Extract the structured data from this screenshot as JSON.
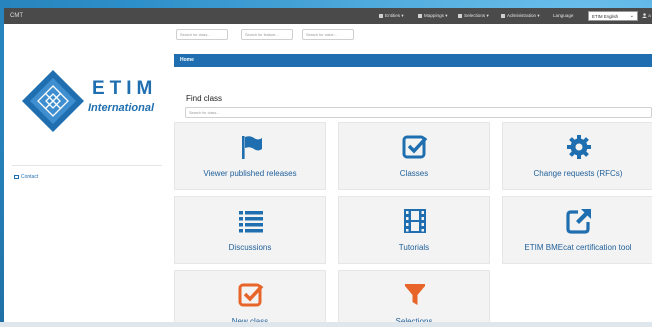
{
  "topnav": {
    "brand": "CMT",
    "items": [
      "Entities",
      "Mappings",
      "Selections",
      "Administration",
      "Language"
    ],
    "language": "ETIM English",
    "user_icon": "user-icon"
  },
  "search": {
    "class_placeholder": "Search for class...",
    "feature_placeholder": "Search for feature...",
    "value_placeholder": "Search for value..."
  },
  "logo": {
    "name": "ETIM",
    "sub": "International"
  },
  "sidebar": {
    "contact": "Contact"
  },
  "breadcrumb": "Home",
  "find": {
    "title": "Find class",
    "placeholder": "Search for class..."
  },
  "tiles": [
    {
      "label": "Viewer published releases",
      "icon": "flag-icon",
      "color": "#1f6fb0"
    },
    {
      "label": "Classes",
      "icon": "check-square-icon",
      "color": "#1f6fb0"
    },
    {
      "label": "Change requests (RFCs)",
      "icon": "gear-icon",
      "color": "#1f6fb0"
    },
    {
      "label": "Discussions",
      "icon": "list-icon",
      "color": "#1f6fb0"
    },
    {
      "label": "Tutorials",
      "icon": "film-icon",
      "color": "#1f6fb0"
    },
    {
      "label": "ETIM BMEcat certification tool",
      "icon": "external-link-icon",
      "color": "#1f6fb0"
    },
    {
      "label": "New class",
      "icon": "check-square-icon",
      "color": "#e8652a"
    },
    {
      "label": "Selections",
      "icon": "filter-icon",
      "color": "#e8652a"
    }
  ]
}
